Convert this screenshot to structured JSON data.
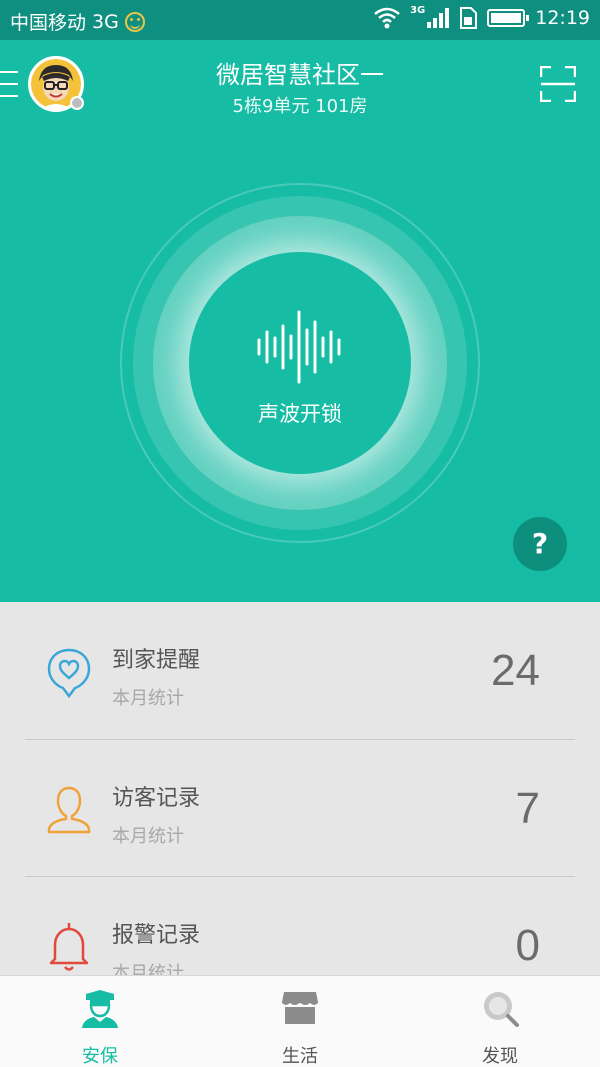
{
  "status_bar": {
    "carrier": "中国移动",
    "network": "3G",
    "network_small": "3G",
    "time": "12:19"
  },
  "header": {
    "community_name": "微居智慧社区一",
    "address": "5栋9单元 101房"
  },
  "unlock": {
    "label": "声波开锁",
    "help_label": "?"
  },
  "stats": [
    {
      "title": "到家提醒",
      "subtitle": "本月统计",
      "value": "24",
      "icon": "heart-location-icon",
      "color": "#3aa6d8"
    },
    {
      "title": "访客记录",
      "subtitle": "本月统计",
      "value": "7",
      "icon": "person-icon",
      "color": "#f0a23a"
    },
    {
      "title": "报警记录",
      "subtitle": "本月统计",
      "value": "0",
      "icon": "bell-icon",
      "color": "#e2483c"
    }
  ],
  "bottom_nav": [
    {
      "label": "安保",
      "icon": "security-guard-icon",
      "active": true
    },
    {
      "label": "生活",
      "icon": "store-icon",
      "active": false
    },
    {
      "label": "发现",
      "icon": "discover-search-icon",
      "active": false
    }
  ],
  "colors": {
    "primary": "#16bca4",
    "primary_dark": "#0e8f7d",
    "status_bar": "#0f8f7f"
  }
}
